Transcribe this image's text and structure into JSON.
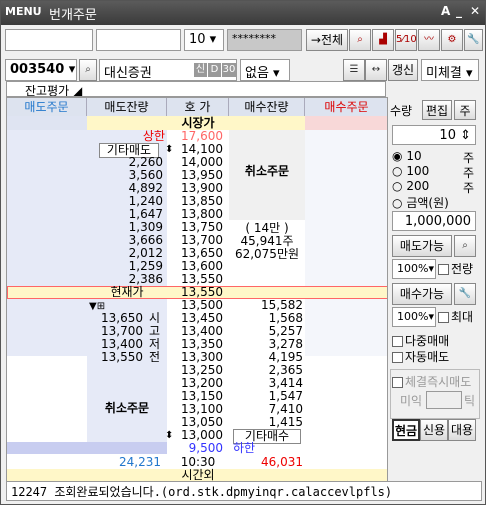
{
  "title": {
    "menu": "MENU",
    "window": "번개주문",
    "ctl_a": "A",
    "ctl_min": "_",
    "ctl_close": "✕"
  },
  "toolbar1": {
    "qty_select": "10",
    "password": "********",
    "transfer": "→전체"
  },
  "toolbar2": {
    "code": "003540",
    "name": "대신증권",
    "badge1": "신",
    "badge2": "D",
    "badge3": "30",
    "option": "없음",
    "refresh": "갱신",
    "unfilled": "미체결"
  },
  "subbar": {
    "label": "잔고평가"
  },
  "grid": {
    "headers": {
      "sell_order": "매도주문",
      "sell_rem": "매도잔량",
      "price": "호   가",
      "buy_rem": "매수잔량",
      "buy_order": "매수주문"
    },
    "market_price_label": "시장가",
    "upper_label": "상한",
    "upper_price": "17,600",
    "other_sell": "기타매도",
    "cancel_top": "취소주문",
    "sell_rows": [
      {
        "rem": "",
        "price": "14,100"
      },
      {
        "rem": "2,260",
        "price": "14,000"
      },
      {
        "rem": "3,560",
        "price": "13,950"
      },
      {
        "rem": "4,892",
        "price": "13,900"
      },
      {
        "rem": "1,240",
        "price": "13,850"
      },
      {
        "rem": "1,647",
        "price": "13,800"
      },
      {
        "rem": "1,309",
        "price": "13,750"
      },
      {
        "rem": "3,666",
        "price": "13,700"
      },
      {
        "rem": "2,012",
        "price": "13,650"
      },
      {
        "rem": "1,259",
        "price": "13,600"
      },
      {
        "rem": "2,386",
        "price": "13,550"
      }
    ],
    "info": {
      "l1": "( 14만 )",
      "l2": "45,941주",
      "l3": "62,075만원"
    },
    "current_label": "현재가",
    "current_price": "13,550",
    "ohlc": [
      {
        "price": "13,650",
        "tag": "시"
      },
      {
        "price": "13,700",
        "tag": "고"
      },
      {
        "price": "13,400",
        "tag": "저"
      },
      {
        "price": "13,550",
        "tag": "전"
      }
    ],
    "cancel_bottom": "취소주문",
    "other_buy": "기타매수",
    "buy_rows": [
      {
        "price": "13,500",
        "rem": "15,582"
      },
      {
        "price": "13,450",
        "rem": "1,568"
      },
      {
        "price": "13,400",
        "rem": "5,257"
      },
      {
        "price": "13,350",
        "rem": "3,278"
      },
      {
        "price": "13,300",
        "rem": "4,195"
      },
      {
        "price": "13,250",
        "rem": "2,365"
      },
      {
        "price": "13,200",
        "rem": "3,414"
      },
      {
        "price": "13,150",
        "rem": "1,547"
      },
      {
        "price": "13,100",
        "rem": "7,410"
      },
      {
        "price": "13,050",
        "rem": "1,415"
      },
      {
        "price": "13,000",
        "rem": ""
      }
    ],
    "lower_price": "9,500",
    "lower_label": "하한",
    "total_sell": "24,231",
    "time": "10:30",
    "total_buy": "46,031",
    "after_hours": "시간외"
  },
  "side": {
    "qty_label": "수량",
    "edit": "편집",
    "main": "주",
    "qty_value": "10",
    "radios": [
      {
        "label": "10",
        "unit": "주"
      },
      {
        "label": "100",
        "unit": "주"
      },
      {
        "label": "200",
        "unit": "주"
      },
      {
        "label": "금액(원)",
        "unit": ""
      }
    ],
    "amount": "1,000,000",
    "sell_avail": "매도가능",
    "pct1": "100%",
    "all1": "전량",
    "buy_avail": "매수가능",
    "pct2": "100%",
    "max2": "최대",
    "multi": "다중매매",
    "auto_sell": "자동매도",
    "instant": "체결즉시매도",
    "not_filled": "미익",
    "tick": "틱",
    "cash": "현금",
    "credit": "신용",
    "loan": "대용"
  },
  "status": "12247 조회완료되었습니다.(ord.stk.dpmyinqr.calaccevlpfls)"
}
